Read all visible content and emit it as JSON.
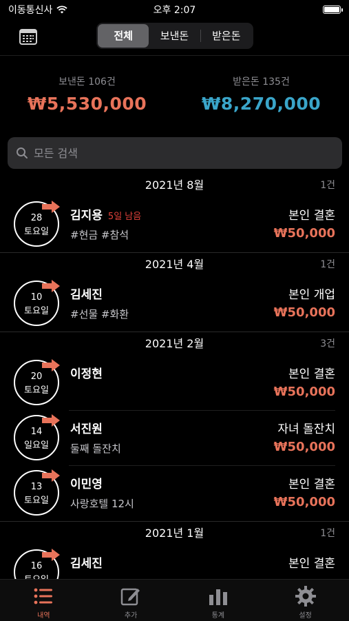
{
  "status": {
    "carrier": "이동통신사",
    "time": "오후 2:07"
  },
  "segments": [
    "전체",
    "보낸돈",
    "받은돈"
  ],
  "summary": {
    "sent_label": "보낸돈 106건",
    "sent_amount": "₩5,530,000",
    "received_label": "받은돈 135건",
    "received_amount": "₩8,270,000"
  },
  "search": {
    "placeholder": "모든 검색"
  },
  "months": [
    {
      "title": "2021년 8월",
      "count": "1건",
      "items": [
        {
          "day": "28",
          "weekday": "토요일",
          "name": "김지용",
          "remain": "5일 남음",
          "tags": "#현금 #참석",
          "event": "본인 결혼",
          "amount": "₩50,000"
        }
      ]
    },
    {
      "title": "2021년 4월",
      "count": "1건",
      "items": [
        {
          "day": "10",
          "weekday": "토요일",
          "name": "김세진",
          "tags": "#선물 #화환",
          "event": "본인 개업",
          "amount": "₩50,000"
        }
      ]
    },
    {
      "title": "2021년 2월",
      "count": "3건",
      "items": [
        {
          "day": "20",
          "weekday": "토요일",
          "name": "이정현",
          "tags": "",
          "event": "본인 결혼",
          "amount": "₩50,000"
        },
        {
          "day": "14",
          "weekday": "일요일",
          "name": "서진원",
          "tags": "둘째 돌잔치",
          "event": "자녀 돌잔치",
          "amount": "₩50,000"
        },
        {
          "day": "13",
          "weekday": "토요일",
          "name": "이민영",
          "tags": "사랑호텔 12시",
          "event": "본인 결혼",
          "amount": "₩50,000"
        }
      ]
    },
    {
      "title": "2021년 1월",
      "count": "1건",
      "items": [
        {
          "day": "16",
          "weekday": "토요일",
          "name": "김세진",
          "tags": "",
          "event": "본인 결혼",
          "amount": ""
        }
      ]
    }
  ],
  "tabs": [
    "내역",
    "추가",
    "통계",
    "설정"
  ],
  "colors": {
    "sent": "#e8735a",
    "received": "#3aa5c9",
    "remain": "#e0413a"
  }
}
